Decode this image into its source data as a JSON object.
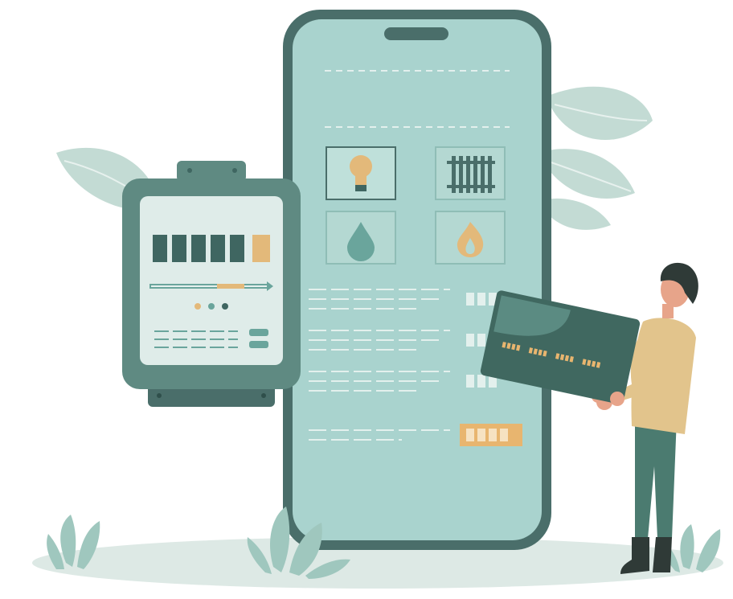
{
  "illustration": {
    "colors": {
      "phone_body": "#4a6e6a",
      "phone_screen": "#a9d3ce",
      "meter_body": "#5f8a82",
      "meter_screen": "#dfece9",
      "digit_dark": "#3f6661",
      "digit_accent": "#e3b97a",
      "leaf": "#bdd6cf",
      "ground": "#cfded9",
      "card": "#406860",
      "person_shirt": "#e2c48c",
      "person_pants": "#4b7b70",
      "accent_orange": "#e8b56f"
    },
    "phone": {
      "utility_icons": [
        "lightbulb-icon",
        "radiator-icon",
        "water-drop-icon",
        "flame-icon"
      ]
    },
    "meter": {
      "digit_count": 6,
      "indicator_dots": [
        "#e3b97a",
        "#6aa59c",
        "#3f6661"
      ]
    }
  }
}
